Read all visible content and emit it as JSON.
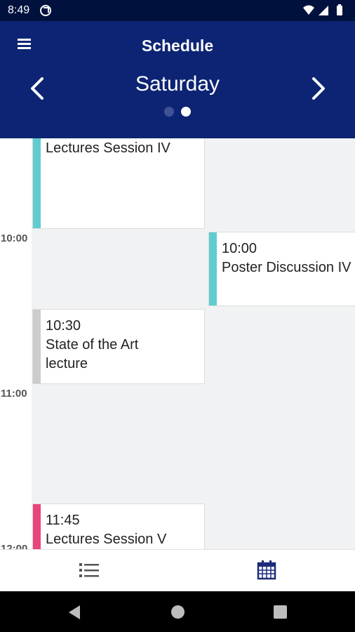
{
  "status_bar": {
    "time": "8:49",
    "icons": [
      "at-notification-icon",
      "wifi-icon",
      "signal-icon",
      "battery-icon"
    ]
  },
  "app_bar": {
    "title": "Schedule",
    "day": "Saturday",
    "menu_icon": "menu-icon",
    "prev_icon": "chevron-left-icon",
    "next_icon": "chevron-right-icon",
    "page_count": 2,
    "active_page": 2
  },
  "schedule": {
    "time_labels": [
      "10:00",
      "11:00",
      "12:00"
    ],
    "events": [
      {
        "time": "",
        "title": "Lectures Session IV",
        "color": "#5fcdd0"
      },
      {
        "time": "10:00",
        "title": "Poster Discussion IV",
        "color": "#5fcdd0"
      },
      {
        "time": "10:30",
        "title": "State of the Art lecture",
        "color": "#cccccc"
      },
      {
        "time": "11:45",
        "title": "Lectures Session V",
        "color": "#e8457a"
      }
    ]
  },
  "bottom_nav": {
    "items": [
      {
        "icon": "list-icon",
        "active": false
      },
      {
        "icon": "calendar-icon",
        "active": true
      }
    ]
  },
  "system_nav": {
    "icons": [
      "back-icon",
      "home-icon",
      "recents-icon"
    ]
  },
  "colors": {
    "status_bar": "#00113d",
    "app_bar": "#0c2473",
    "accent": "#1c2a7a",
    "background": "#f1f2f3"
  }
}
